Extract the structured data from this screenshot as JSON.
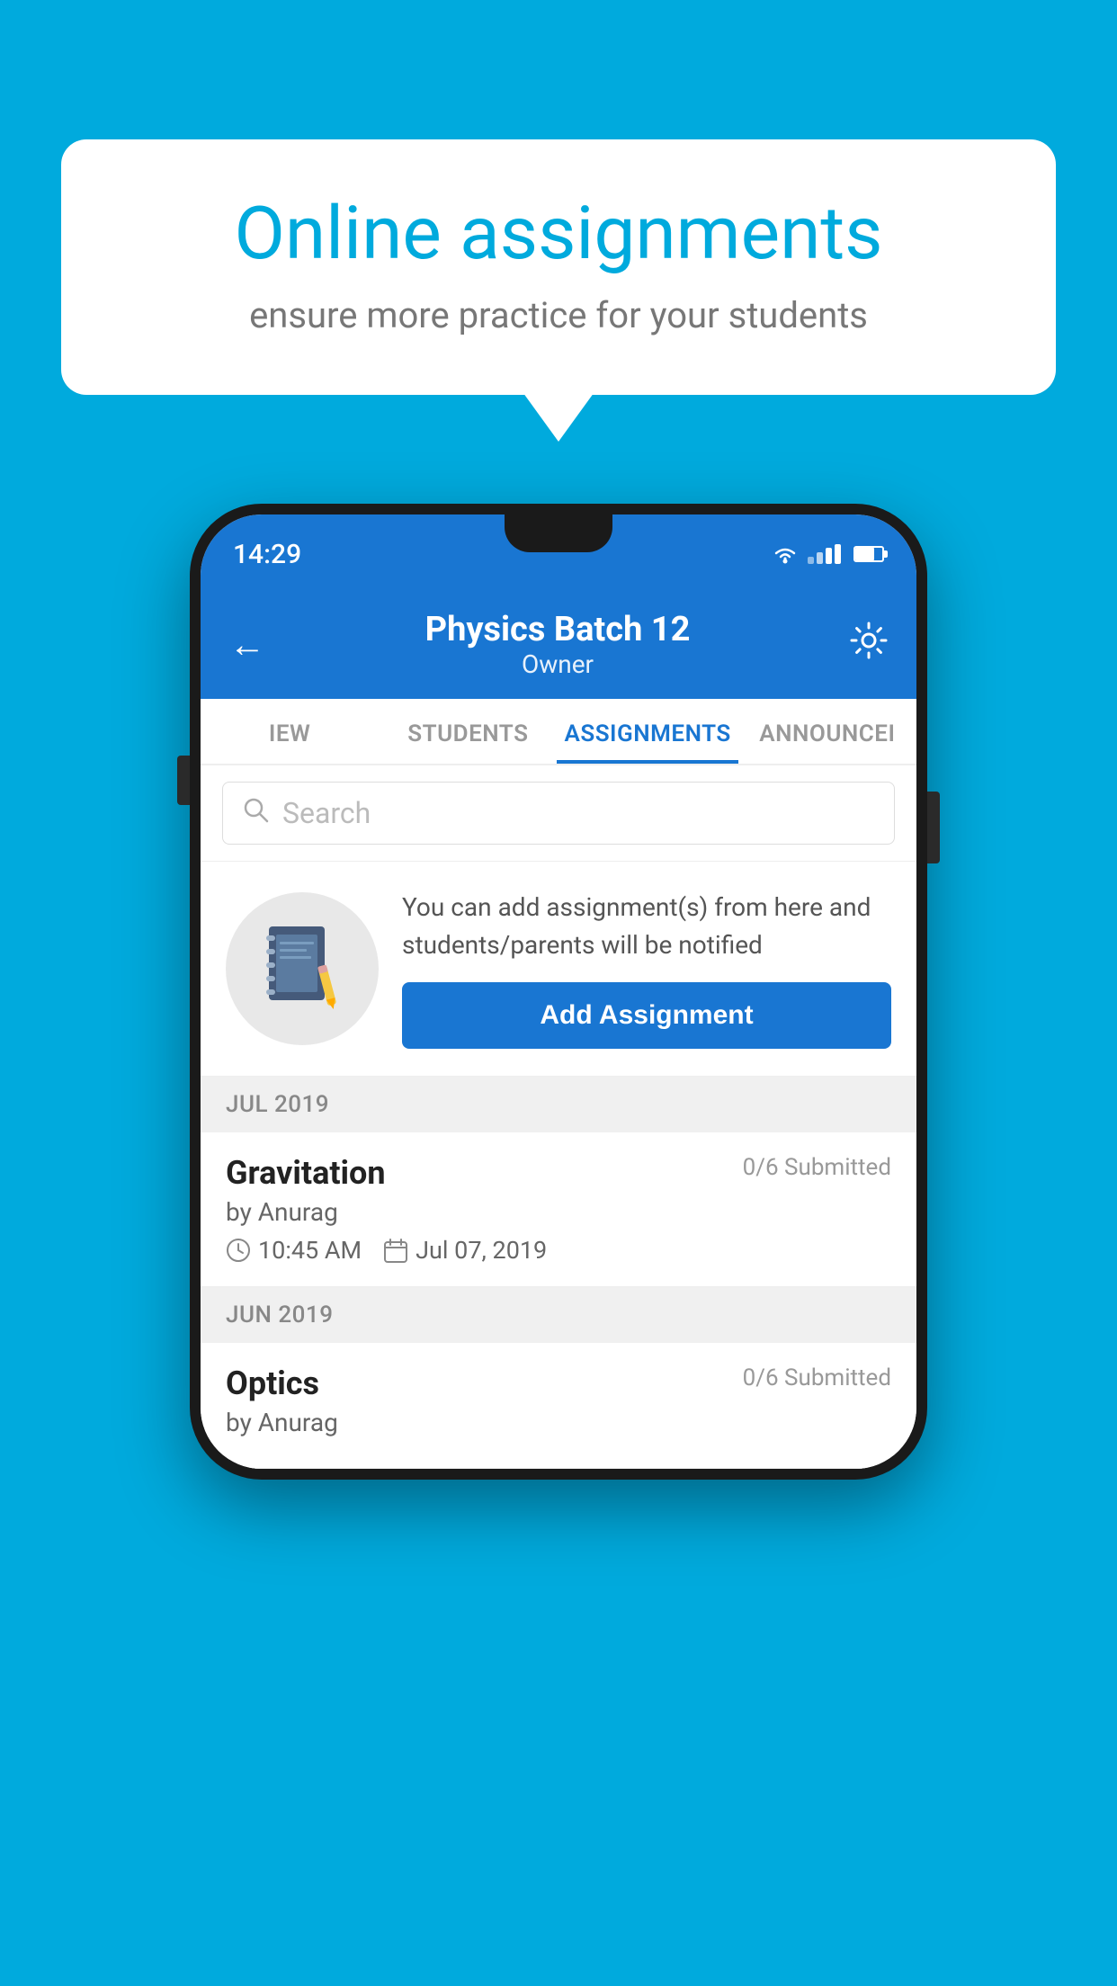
{
  "background_color": "#00AADD",
  "speech_bubble": {
    "title": "Online assignments",
    "subtitle": "ensure more practice for your students"
  },
  "phone": {
    "status_bar": {
      "time": "14:29"
    },
    "header": {
      "title": "Physics Batch 12",
      "subtitle": "Owner",
      "back_icon": "←",
      "settings_icon": "⚙"
    },
    "tabs": [
      {
        "label": "IEW",
        "active": false
      },
      {
        "label": "STUDENTS",
        "active": false
      },
      {
        "label": "ASSIGNMENTS",
        "active": true
      },
      {
        "label": "ANNOUNCEMENTS",
        "active": false
      }
    ],
    "search": {
      "placeholder": "Search"
    },
    "promo": {
      "text": "You can add assignment(s) from here and students/parents will be notified",
      "button_label": "Add Assignment"
    },
    "sections": [
      {
        "label": "JUL 2019",
        "assignments": [
          {
            "title": "Gravitation",
            "submitted": "0/6 Submitted",
            "author": "by Anurag",
            "time": "10:45 AM",
            "date": "Jul 07, 2019"
          }
        ]
      },
      {
        "label": "JUN 2019",
        "assignments": [
          {
            "title": "Optics",
            "submitted": "0/6 Submitted",
            "author": "by Anurag",
            "time": "",
            "date": ""
          }
        ]
      }
    ]
  }
}
